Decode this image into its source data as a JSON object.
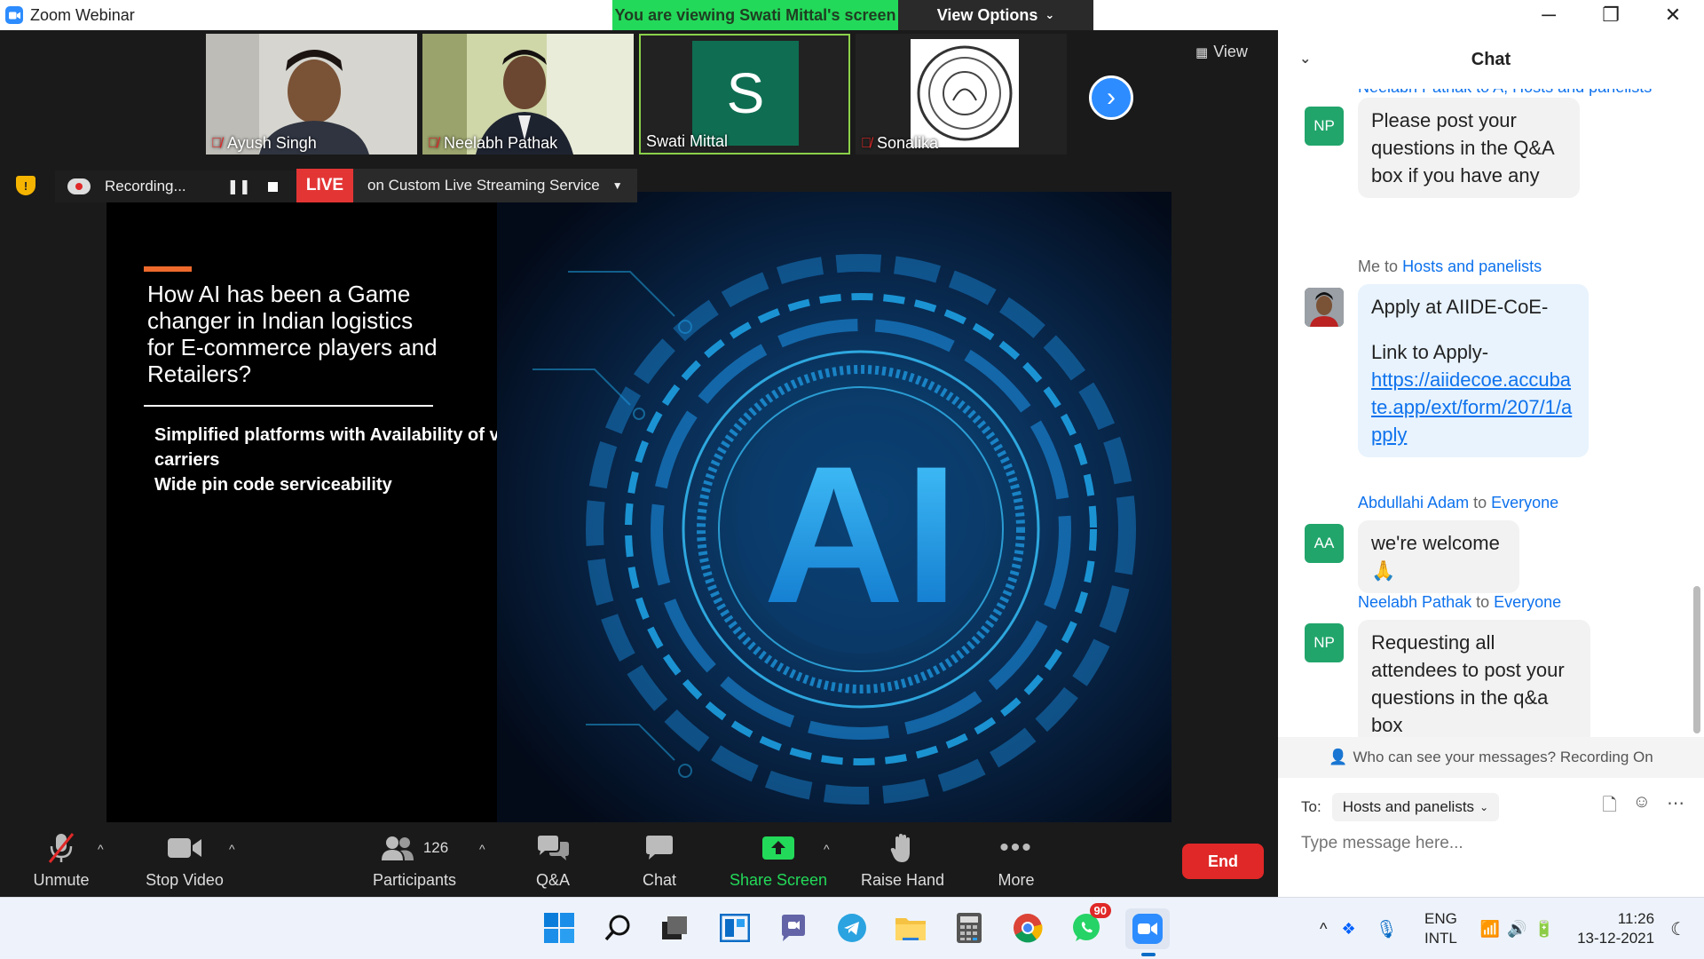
{
  "window": {
    "title": "Zoom Webinar",
    "minimize": "─",
    "maximize": "❐",
    "close": "✕"
  },
  "banner": {
    "viewing": "You are viewing Swati Mittal's screen",
    "view_options": "View Options"
  },
  "participants_strip": [
    {
      "name": "Ayush Singh",
      "muted": true
    },
    {
      "name": "Neelabh Pathak",
      "muted": true
    },
    {
      "name": "Swati Mittal",
      "muted": false,
      "initial": "S"
    },
    {
      "name": "Sonalika",
      "muted": true
    }
  ],
  "view_button": "View",
  "recording": {
    "label": "Recording...",
    "live": "LIVE",
    "service": "on Custom Live Streaming Service"
  },
  "slide": {
    "title": "How AI has been a Game changer in Indian logistics for E-commerce players and Retailers?",
    "bullets": [
      "Simplified platforms with Availability of vast number of carriers",
      "Wide pin code serviceability"
    ],
    "art_text": "AI"
  },
  "toolbar": {
    "unmute": "Unmute",
    "stop_video": "Stop Video",
    "participants": "Participants",
    "participant_count": "126",
    "qa": "Q&A",
    "chat": "Chat",
    "share_screen": "Share Screen",
    "raise_hand": "Raise Hand",
    "more": "More",
    "end": "End"
  },
  "chat": {
    "title": "Chat",
    "clipped_header": "Neelabh Pathak to A, Hosts and panelists",
    "messages": [
      {
        "avatar": "NP",
        "text": "Please post your questions in the Q&A box if you have any"
      },
      {
        "sender": "Me",
        "to_word": "to",
        "recipient": "Hosts and panelists",
        "text_line1": "Apply at AIIDE-CoE-",
        "text_line2": "Link to Apply-",
        "link": "https://aiidecoe.accubate.app/ext/form/207/1/apply"
      },
      {
        "sender": "Abdullahi Adam",
        "to_word": "to",
        "recipient": "Everyone",
        "avatar": "AA",
        "text": "we're welcome 🙏"
      },
      {
        "sender": "Neelabh Pathak",
        "to_word": "to",
        "recipient": "Everyone",
        "avatar": "NP",
        "text": "Requesting all attendees to post your questions in the q&a box"
      }
    ],
    "privacy_note": "Who can see your messages? Recording On",
    "to_label": "To:",
    "to_value": "Hosts and panelists",
    "input_placeholder": "Type message here..."
  },
  "taskbar": {
    "whatsapp_badge": "90",
    "lang_line1": "ENG",
    "lang_line2": "INTL",
    "time": "11:26",
    "date": "13-12-2021"
  },
  "colors": {
    "zoom_blue": "#2d8cff",
    "live_red": "#e43535",
    "end_red": "#e02828",
    "share_green": "#23d959",
    "avatar_green": "#21a56b",
    "slide_accent": "#ee6a2c"
  }
}
